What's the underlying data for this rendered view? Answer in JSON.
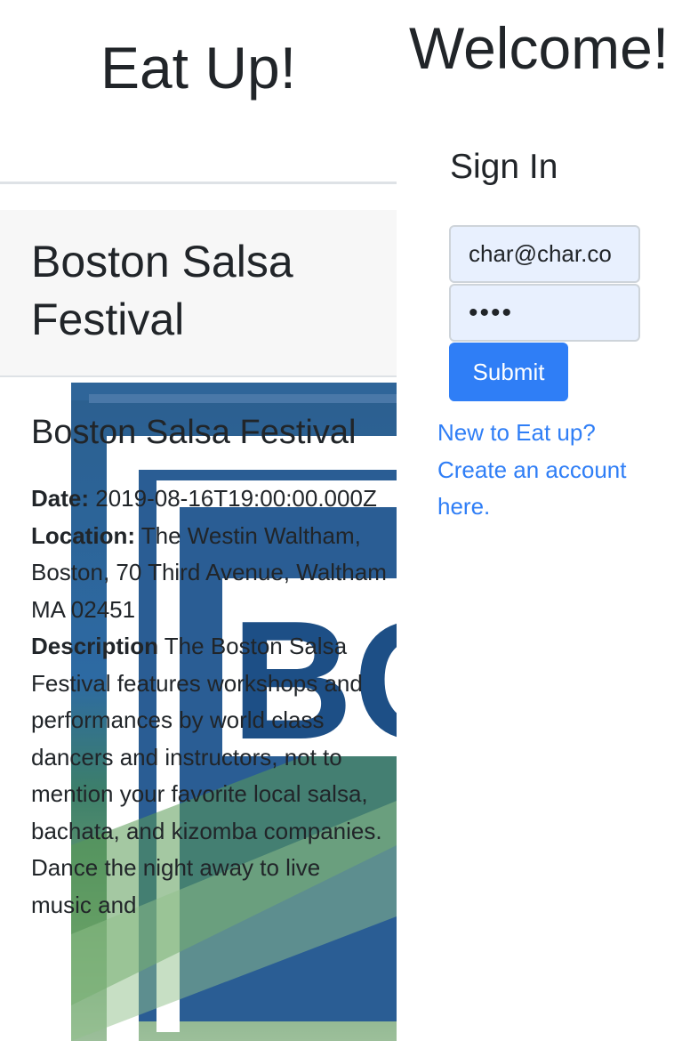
{
  "header": {
    "app_title": "Eat Up!"
  },
  "event": {
    "header_title": "Boston Salsa Festival",
    "title": "Boston Salsa Festival",
    "date_label": "Date:",
    "date": "2019-08-16T19:00:00.000Z",
    "location_label": "Location:",
    "location": "The Westin Waltham, Boston, 70 Third Avenue, Waltham MA 02451",
    "description_label": "Description",
    "description": "The Boston Salsa Festival features workshops and performances by world class dancers and instructors, not to mention your favorite local salsa, bachata, and kizomba companies. Dance the night away to live music and",
    "image_text": "BO"
  },
  "auth": {
    "welcome": "Welcome!",
    "signin_heading": "Sign In",
    "email_value": "char@char.co",
    "password_mask": "••••",
    "submit_label": "Submit",
    "signup_link": "New to Eat up? Create an account here."
  }
}
